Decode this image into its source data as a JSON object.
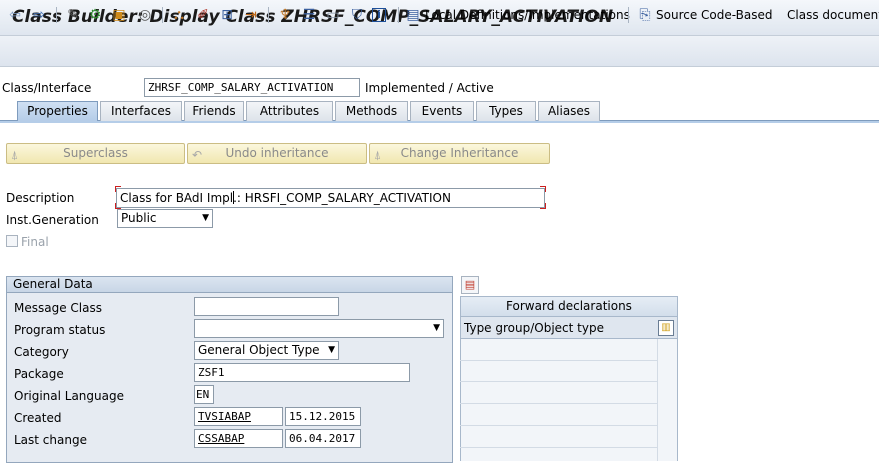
{
  "title": "Class Builder: Display Class ZHRSF_COMP_SALARY_ACTIVATION",
  "toolbar": {
    "local_definitions_label": "Local Definitions/Implementations",
    "source_code_label": "Source Code-Based",
    "class_doc_label": "Class documentati"
  },
  "header": {
    "class_interface_label": "Class/Interface",
    "class_name": "ZHRSF_COMP_SALARY_ACTIVATION",
    "status": "Implemented / Active"
  },
  "tabs": [
    {
      "label": "Properties",
      "active": true
    },
    {
      "label": "Interfaces"
    },
    {
      "label": "Friends"
    },
    {
      "label": "Attributes"
    },
    {
      "label": "Methods"
    },
    {
      "label": "Events"
    },
    {
      "label": "Types"
    },
    {
      "label": "Aliases"
    }
  ],
  "buttons": {
    "superclass": "Superclass",
    "undo_inheritance": "Undo inheritance",
    "change_inheritance": "Change Inheritance"
  },
  "properties": {
    "description_label": "Description",
    "description_value": "Class for BAdI Impl.: HRSFI_COMP_SALARY_ACTIVATION",
    "inst_generation_label": "Inst.Generation",
    "inst_generation_value": "Public",
    "final_label": "Final"
  },
  "general_data": {
    "title": "General Data",
    "message_class_label": "Message Class",
    "message_class_value": "",
    "program_status_label": "Program status",
    "program_status_value": "",
    "category_label": "Category",
    "category_value": "General Object Type",
    "package_label": "Package",
    "package_value": "ZSF1",
    "original_language_label": "Original Language",
    "original_language_value": "EN",
    "created_label": "Created",
    "created_by": "TVSIABAP",
    "created_on": "15.12.2015",
    "last_change_label": "Last change",
    "changed_by": "CSSABAP",
    "changed_on": "06.04.2017"
  },
  "forward_declarations": {
    "title": "Forward declarations",
    "column_header": "Type group/Object type"
  },
  "colors": {
    "active_tab": "#b5cde8",
    "button_bg": "#f1e7b0",
    "group_bg": "#e6ebf2"
  }
}
